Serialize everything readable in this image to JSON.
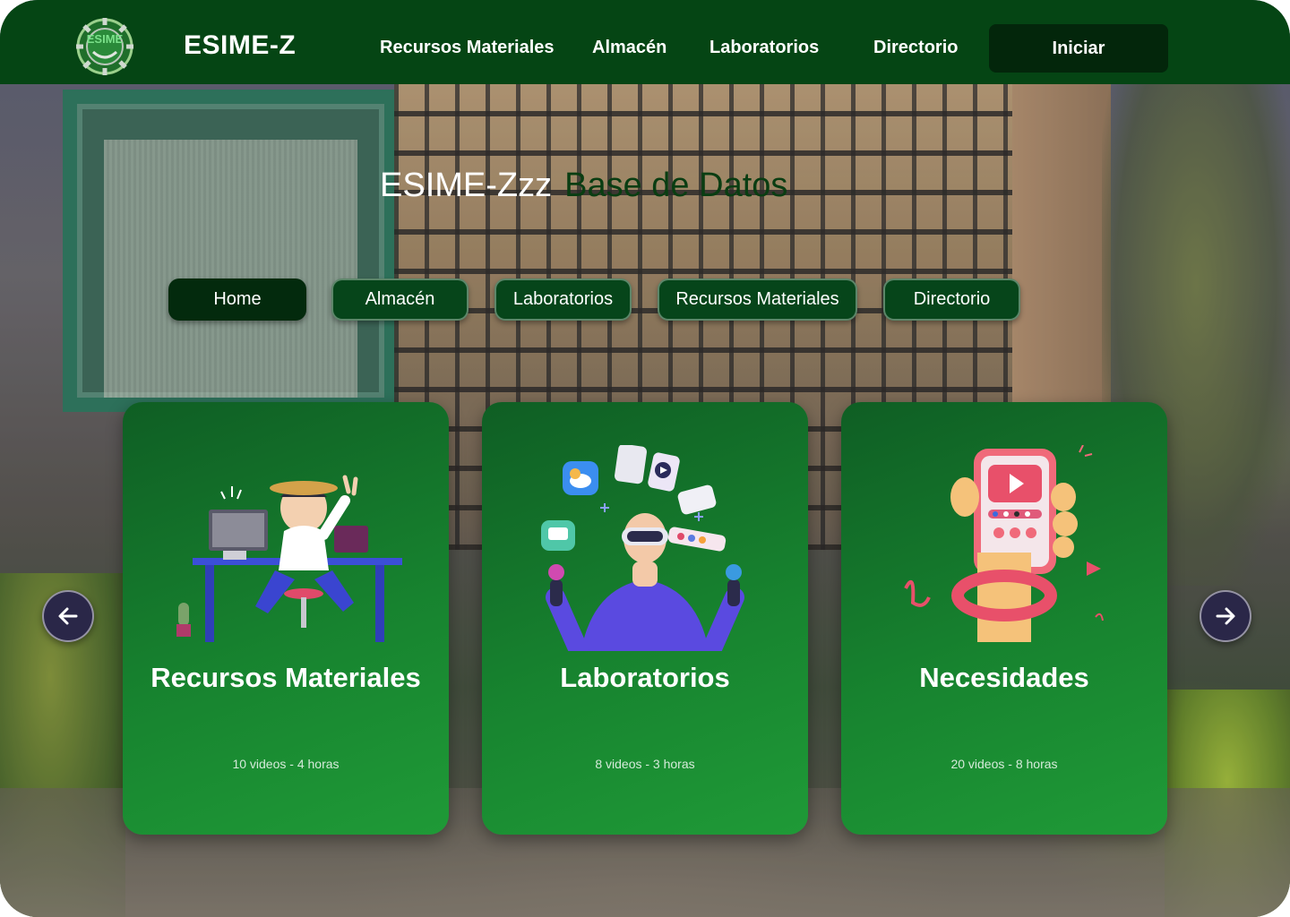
{
  "header": {
    "logo_text": "ESIME",
    "brand": "ESIME-Z",
    "nav": [
      "Recursos Materiales",
      "Almacén",
      "Laboratorios",
      "Directorio"
    ],
    "cta": "Iniciar"
  },
  "hero": {
    "title_part1": "ESIME-Zzz",
    "title_part2": "Base de Datos"
  },
  "tabs": [
    {
      "label": "Home",
      "active": true
    },
    {
      "label": "Almacén",
      "active": false
    },
    {
      "label": "Laboratorios",
      "active": false
    },
    {
      "label": "Recursos Materiales",
      "active": false
    },
    {
      "label": "Directorio",
      "active": false
    }
  ],
  "cards": [
    {
      "title": "Recursos Materiales",
      "meta": "10 videos - 4 horas",
      "illustration": "person-at-desk-illustration"
    },
    {
      "title": "Laboratorios",
      "meta": "8 videos - 3 horas",
      "illustration": "vr-person-juggling-apps-illustration"
    },
    {
      "title": "Necesidades",
      "meta": "20 videos - 8 horas",
      "illustration": "hand-holding-phone-illustration"
    }
  ],
  "carousel": {
    "prev_icon": "arrow-left-icon",
    "next_icon": "arrow-right-icon"
  },
  "colors": {
    "header_bg": "#054514",
    "cta_bg": "#03260b",
    "card_green": "#17832f",
    "arrow_bg": "#2a2748"
  }
}
